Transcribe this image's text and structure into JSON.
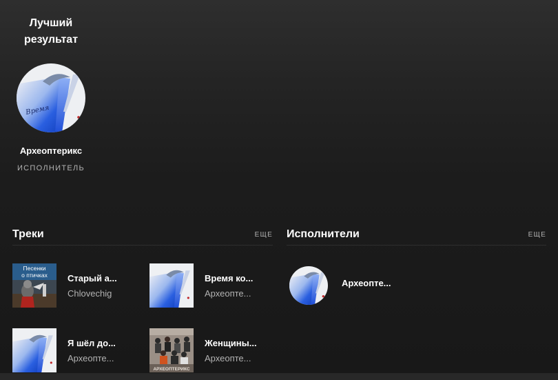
{
  "top_result": {
    "heading": "Лучший результат",
    "name": "Археоптерикс",
    "type": "ИСПОЛНИТЕЛЬ",
    "cover_text": "Время"
  },
  "tracks_section": {
    "title": "Треки",
    "more": "ЕЩЕ",
    "items": [
      {
        "title": "Старый а...",
        "artist": "Chlovechig",
        "cover": "birds-songs-cover",
        "cover_text_1": "Песенки",
        "cover_text_2": "о птичках"
      },
      {
        "title": "Время ко...",
        "artist": "Археопте...",
        "cover": "blue-sky-cover"
      },
      {
        "title": "Я шёл до...",
        "artist": "Археопте...",
        "cover": "blue-sky-cover"
      },
      {
        "title": "Женщины...",
        "artist": "Археопте...",
        "cover": "band-photo-cover",
        "cover_text": "АРХЕОПТЕРИКС"
      }
    ]
  },
  "artists_section": {
    "title": "Исполнители",
    "more": "ЕЩЕ",
    "items": [
      {
        "name": "Археопте...",
        "cover": "blue-sky-cover"
      }
    ]
  }
}
